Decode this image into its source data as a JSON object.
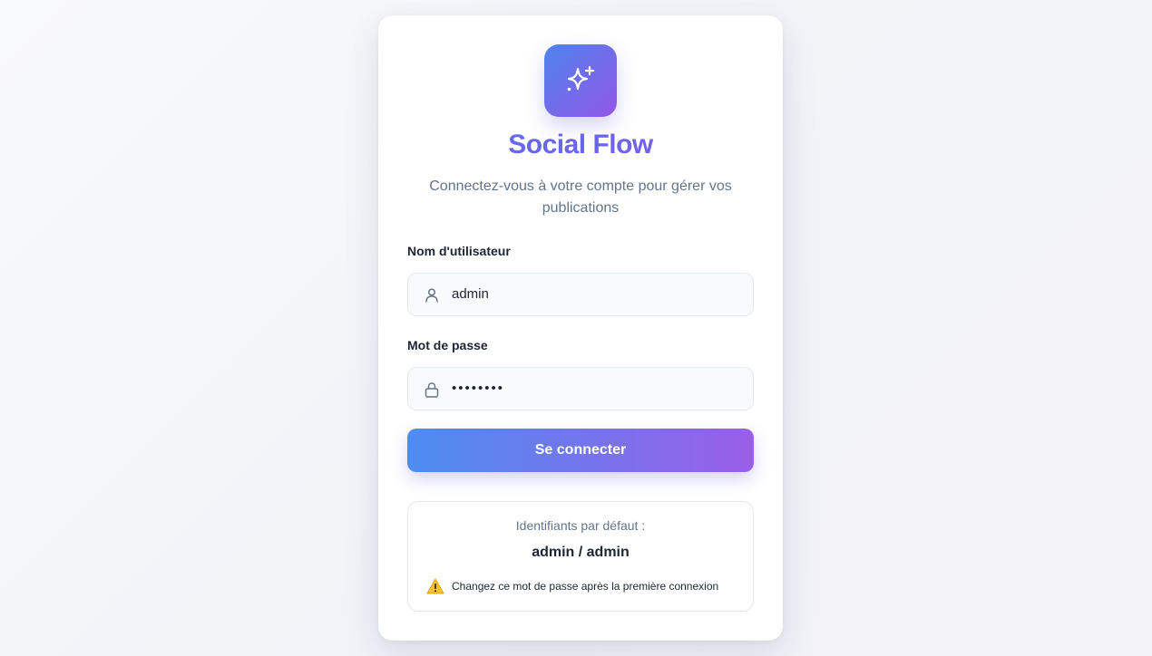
{
  "app": {
    "title": "Social Flow",
    "subtitle": "Connectez-vous à votre compte pour gérer vos publications",
    "logo_icon": "sparkles-icon"
  },
  "form": {
    "username_label": "Nom d'utilisateur",
    "username_value": "admin",
    "username_icon": "user-icon",
    "password_label": "Mot de passe",
    "password_value": "••••••••",
    "password_icon": "lock-icon",
    "submit_label": "Se connecter"
  },
  "defaults": {
    "title": "Identifiants par défaut :",
    "credentials": "admin / admin",
    "warning_icon": "warning-icon",
    "warning": "Changez ce mot de passe après la première connexion"
  },
  "colors": {
    "accent_start": "#4f83ee",
    "accent_end": "#9356e6",
    "title_color": "#6366f1",
    "muted_text": "#64748b"
  }
}
